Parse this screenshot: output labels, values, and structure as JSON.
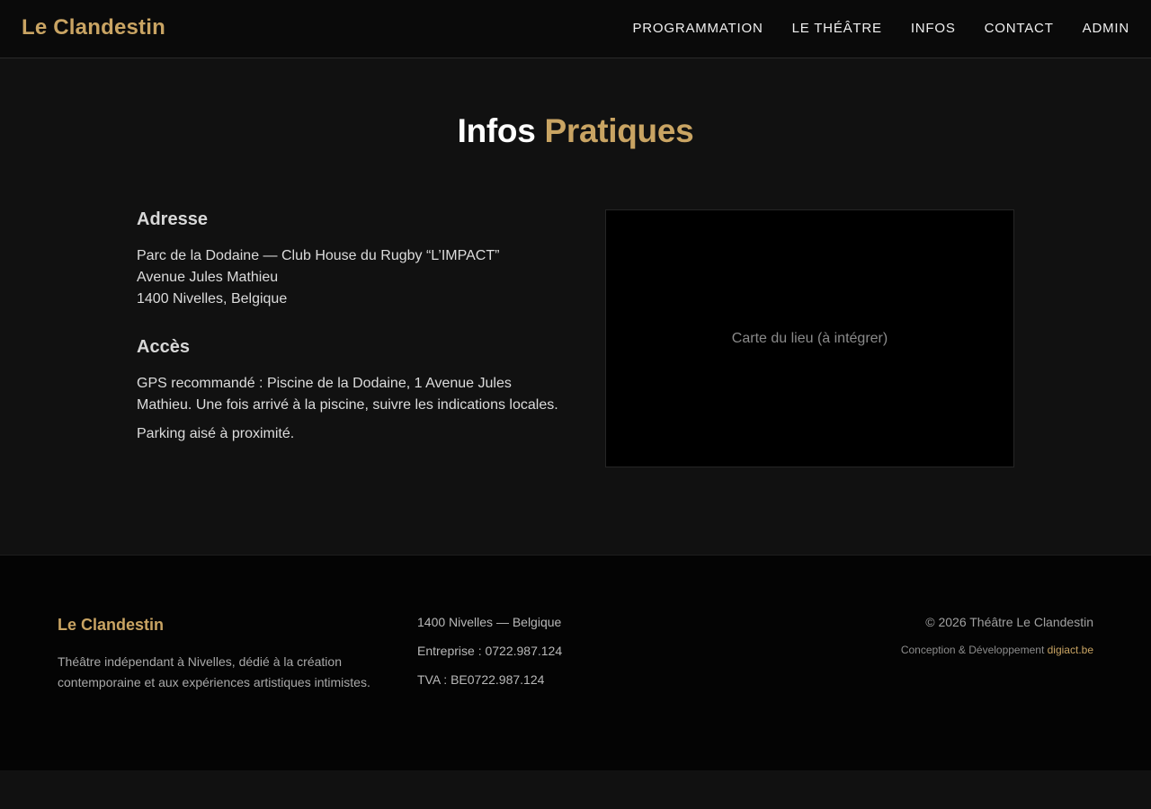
{
  "header": {
    "brand": "Le Clandestin",
    "nav": [
      "PROGRAMMATION",
      "LE THÉÂTRE",
      "INFOS",
      "CONTACT",
      "ADMIN"
    ]
  },
  "main": {
    "title_plain": "Infos",
    "title_accent": "Pratiques",
    "address": {
      "heading": "Adresse",
      "lines": [
        "Parc de la Dodaine — Club House du Rugby “L’IMPACT”",
        "Avenue Jules Mathieu",
        "1400 Nivelles, Belgique"
      ]
    },
    "access": {
      "heading": "Accès",
      "paragraphs": [
        "GPS recommandé : Piscine de la Dodaine, 1 Avenue Jules Mathieu. Une fois arrivé à la piscine, suivre les indications locales.",
        "Parking aisé à proximité."
      ]
    },
    "map_placeholder": "Carte du lieu (à intégrer)"
  },
  "footer": {
    "brand": "Le Clandestin",
    "tagline": "Théâtre indépendant à Nivelles, dédié à la création contemporaine et aux expériences artistiques intimistes.",
    "location": "1400 Nivelles — Belgique",
    "company": "Entreprise : 0722.987.124",
    "vat": "TVA : BE0722.987.124",
    "copyright": "© 2026 Théâtre Le Clandestin",
    "credit_prefix": "Conception & Développement",
    "credit_link": "digiact.be"
  },
  "colors": {
    "accent": "#c9a463",
    "background": "#111111",
    "header_bg": "#0a0a0a",
    "footer_bg": "#040404"
  }
}
